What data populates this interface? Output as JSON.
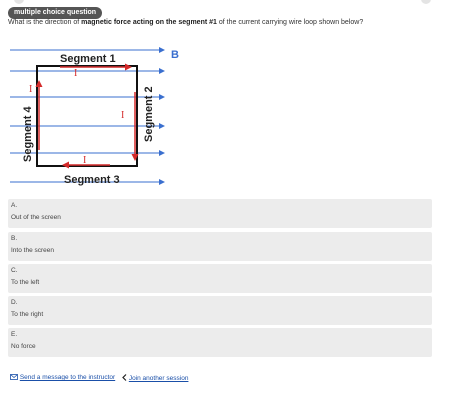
{
  "badge": "multiple choice question",
  "question": {
    "prefix": "What is the direction of ",
    "bold": "magnetic force acting on the segment #1",
    "suffix": " of the current carrying wire loop shown below?"
  },
  "figure": {
    "field_label": "B",
    "segment1": "Segment 1",
    "segment2": "Segment 2",
    "segment3": "Segment 3",
    "segment4": "Segment 4",
    "current_label": "I",
    "field_color": "#3a6fcf",
    "current_color": "#d42a2a"
  },
  "choices": [
    {
      "letter": "A.",
      "text": "Out of the screen"
    },
    {
      "letter": "B.",
      "text": "Into the screen"
    },
    {
      "letter": "C.",
      "text": "To the left"
    },
    {
      "letter": "D.",
      "text": "To the right"
    },
    {
      "letter": "E.",
      "text": "No force"
    }
  ],
  "footer": {
    "message_link": "Send a message to the instructor",
    "join_link": "Join another session",
    "message_icon": "mail-icon",
    "join_icon": "chevron-left-icon"
  }
}
